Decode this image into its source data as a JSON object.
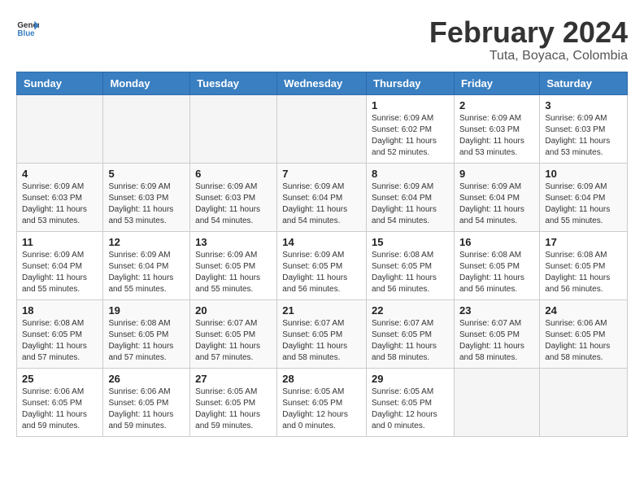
{
  "logo": {
    "text_general": "General",
    "text_blue": "Blue"
  },
  "header": {
    "month": "February 2024",
    "location": "Tuta, Boyaca, Colombia"
  },
  "weekdays": [
    "Sunday",
    "Monday",
    "Tuesday",
    "Wednesday",
    "Thursday",
    "Friday",
    "Saturday"
  ],
  "weeks": [
    [
      {
        "day": "",
        "info": ""
      },
      {
        "day": "",
        "info": ""
      },
      {
        "day": "",
        "info": ""
      },
      {
        "day": "",
        "info": ""
      },
      {
        "day": "1",
        "info": "Sunrise: 6:09 AM\nSunset: 6:02 PM\nDaylight: 11 hours\nand 52 minutes."
      },
      {
        "day": "2",
        "info": "Sunrise: 6:09 AM\nSunset: 6:03 PM\nDaylight: 11 hours\nand 53 minutes."
      },
      {
        "day": "3",
        "info": "Sunrise: 6:09 AM\nSunset: 6:03 PM\nDaylight: 11 hours\nand 53 minutes."
      }
    ],
    [
      {
        "day": "4",
        "info": "Sunrise: 6:09 AM\nSunset: 6:03 PM\nDaylight: 11 hours\nand 53 minutes."
      },
      {
        "day": "5",
        "info": "Sunrise: 6:09 AM\nSunset: 6:03 PM\nDaylight: 11 hours\nand 53 minutes."
      },
      {
        "day": "6",
        "info": "Sunrise: 6:09 AM\nSunset: 6:03 PM\nDaylight: 11 hours\nand 54 minutes."
      },
      {
        "day": "7",
        "info": "Sunrise: 6:09 AM\nSunset: 6:04 PM\nDaylight: 11 hours\nand 54 minutes."
      },
      {
        "day": "8",
        "info": "Sunrise: 6:09 AM\nSunset: 6:04 PM\nDaylight: 11 hours\nand 54 minutes."
      },
      {
        "day": "9",
        "info": "Sunrise: 6:09 AM\nSunset: 6:04 PM\nDaylight: 11 hours\nand 54 minutes."
      },
      {
        "day": "10",
        "info": "Sunrise: 6:09 AM\nSunset: 6:04 PM\nDaylight: 11 hours\nand 55 minutes."
      }
    ],
    [
      {
        "day": "11",
        "info": "Sunrise: 6:09 AM\nSunset: 6:04 PM\nDaylight: 11 hours\nand 55 minutes."
      },
      {
        "day": "12",
        "info": "Sunrise: 6:09 AM\nSunset: 6:04 PM\nDaylight: 11 hours\nand 55 minutes."
      },
      {
        "day": "13",
        "info": "Sunrise: 6:09 AM\nSunset: 6:05 PM\nDaylight: 11 hours\nand 55 minutes."
      },
      {
        "day": "14",
        "info": "Sunrise: 6:09 AM\nSunset: 6:05 PM\nDaylight: 11 hours\nand 56 minutes."
      },
      {
        "day": "15",
        "info": "Sunrise: 6:08 AM\nSunset: 6:05 PM\nDaylight: 11 hours\nand 56 minutes."
      },
      {
        "day": "16",
        "info": "Sunrise: 6:08 AM\nSunset: 6:05 PM\nDaylight: 11 hours\nand 56 minutes."
      },
      {
        "day": "17",
        "info": "Sunrise: 6:08 AM\nSunset: 6:05 PM\nDaylight: 11 hours\nand 56 minutes."
      }
    ],
    [
      {
        "day": "18",
        "info": "Sunrise: 6:08 AM\nSunset: 6:05 PM\nDaylight: 11 hours\nand 57 minutes."
      },
      {
        "day": "19",
        "info": "Sunrise: 6:08 AM\nSunset: 6:05 PM\nDaylight: 11 hours\nand 57 minutes."
      },
      {
        "day": "20",
        "info": "Sunrise: 6:07 AM\nSunset: 6:05 PM\nDaylight: 11 hours\nand 57 minutes."
      },
      {
        "day": "21",
        "info": "Sunrise: 6:07 AM\nSunset: 6:05 PM\nDaylight: 11 hours\nand 58 minutes."
      },
      {
        "day": "22",
        "info": "Sunrise: 6:07 AM\nSunset: 6:05 PM\nDaylight: 11 hours\nand 58 minutes."
      },
      {
        "day": "23",
        "info": "Sunrise: 6:07 AM\nSunset: 6:05 PM\nDaylight: 11 hours\nand 58 minutes."
      },
      {
        "day": "24",
        "info": "Sunrise: 6:06 AM\nSunset: 6:05 PM\nDaylight: 11 hours\nand 58 minutes."
      }
    ],
    [
      {
        "day": "25",
        "info": "Sunrise: 6:06 AM\nSunset: 6:05 PM\nDaylight: 11 hours\nand 59 minutes."
      },
      {
        "day": "26",
        "info": "Sunrise: 6:06 AM\nSunset: 6:05 PM\nDaylight: 11 hours\nand 59 minutes."
      },
      {
        "day": "27",
        "info": "Sunrise: 6:05 AM\nSunset: 6:05 PM\nDaylight: 11 hours\nand 59 minutes."
      },
      {
        "day": "28",
        "info": "Sunrise: 6:05 AM\nSunset: 6:05 PM\nDaylight: 12 hours\nand 0 minutes."
      },
      {
        "day": "29",
        "info": "Sunrise: 6:05 AM\nSunset: 6:05 PM\nDaylight: 12 hours\nand 0 minutes."
      },
      {
        "day": "",
        "info": ""
      },
      {
        "day": "",
        "info": ""
      }
    ]
  ]
}
